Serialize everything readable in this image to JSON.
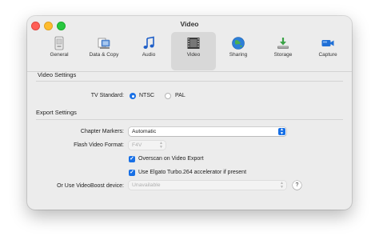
{
  "window": {
    "title": "Video"
  },
  "toolbar": {
    "items": [
      {
        "label": "General",
        "icon": "general-icon"
      },
      {
        "label": "Data & Copy",
        "icon": "data-copy-icon"
      },
      {
        "label": "Audio",
        "icon": "music-note-icon"
      },
      {
        "label": "Video",
        "icon": "film-icon",
        "selected": true
      },
      {
        "label": "Sharing",
        "icon": "globe-icon"
      },
      {
        "label": "Storage",
        "icon": "download-tray-icon"
      },
      {
        "label": "Capture",
        "icon": "video-camera-icon"
      }
    ]
  },
  "video_settings": {
    "heading": "Video Settings",
    "tv_standard_label": "TV Standard:",
    "options": [
      "NTSC",
      "PAL"
    ],
    "selected": "NTSC"
  },
  "export_settings": {
    "heading": "Export Settings",
    "chapter_markers_label": "Chapter Markers:",
    "chapter_markers_value": "Automatic",
    "flash_format_label": "Flash Video Format:",
    "flash_format_value": "F4V",
    "overscan_label": "Overscan on Video Export",
    "overscan_checked": true,
    "turbo_label": "Use Elgato Turbo.264 accelerator if present",
    "turbo_checked": true,
    "videoboost_label": "Or Use VideoBoost device:",
    "videoboost_value": "Unavailable",
    "help_label": "?"
  },
  "colors": {
    "accent": "#1870e6",
    "window_bg": "#ececec"
  }
}
